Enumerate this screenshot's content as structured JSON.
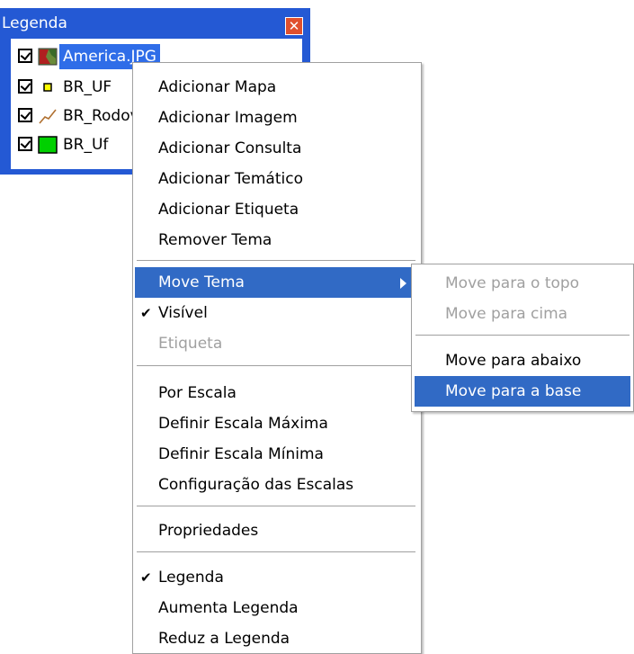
{
  "legend_window": {
    "title": "Legenda",
    "close_icon": "close-icon",
    "layers": [
      {
        "label": "America.JPG",
        "checked": true,
        "icon": "raster-image-icon",
        "selected": true
      },
      {
        "label": "BR_UF",
        "checked": true,
        "icon": "point-layer-icon",
        "selected": false
      },
      {
        "label": "BR_Rodovias",
        "checked": true,
        "icon": "line-layer-icon",
        "selected": false
      },
      {
        "label": "BR_Uf",
        "checked": true,
        "icon": "polygon-layer-icon",
        "selected": false
      }
    ]
  },
  "context_menu": {
    "items": [
      {
        "label": "Adicionar Mapa"
      },
      {
        "label": "Adicionar Imagem"
      },
      {
        "label": "Adicionar Consulta"
      },
      {
        "label": "Adicionar Temático"
      },
      {
        "label": "Adicionar Etiqueta"
      },
      {
        "label": "Remover Tema"
      },
      {
        "label": "Move Tema",
        "has_submenu": true,
        "highlighted": true
      },
      {
        "label": "Visível",
        "checked": true
      },
      {
        "label": "Etiqueta",
        "disabled": true
      },
      {
        "label": "Por Escala"
      },
      {
        "label": "Definir Escala Máxima"
      },
      {
        "label": "Definir Escala Mínima"
      },
      {
        "label": "Configuração das Escalas"
      },
      {
        "label": "Propriedades"
      },
      {
        "label": "Legenda",
        "checked": true
      },
      {
        "label": "Aumenta Legenda"
      },
      {
        "label": "Reduz a Legenda"
      }
    ],
    "check_glyph": "✔"
  },
  "sub_menu": {
    "items": [
      {
        "label": "Move para o topo",
        "disabled": true
      },
      {
        "label": "Move para cima",
        "disabled": true
      },
      {
        "label": "Move para abaixo"
      },
      {
        "label": "Move para a base",
        "highlighted": true
      }
    ]
  },
  "colors": {
    "title_bar": "#2459d4",
    "highlight": "#316ac5",
    "disabled_text": "#a0a0a0",
    "polygon_fill": "#00d000"
  }
}
